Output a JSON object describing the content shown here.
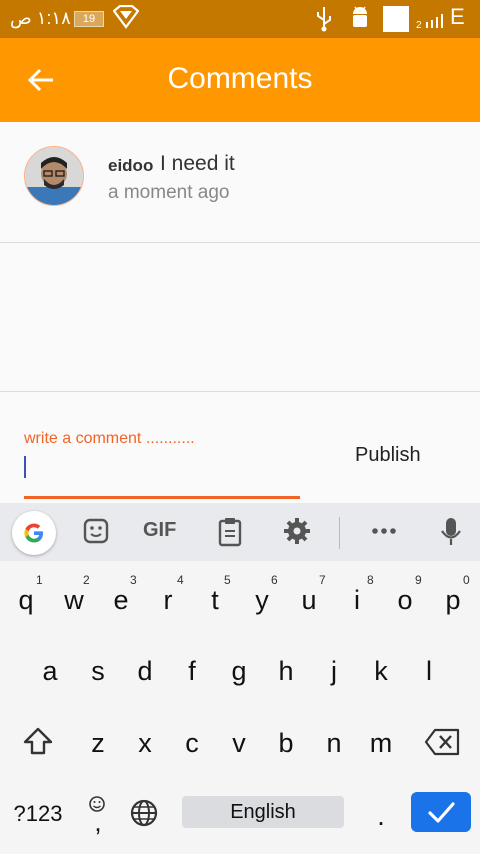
{
  "status_bar": {
    "time": "١:١٨ ص",
    "battery": "19",
    "network": "E",
    "signal": "2"
  },
  "app_bar": {
    "title": "Comments"
  },
  "comment": {
    "user": "eidoo",
    "text": "I need it",
    "time": "a moment ago"
  },
  "composer": {
    "placeholder": "write a comment ...........",
    "publish_label": "Publish"
  },
  "keyboard": {
    "toolbar": {
      "gif_label": "GIF"
    },
    "row1": [
      "q",
      "w",
      "e",
      "r",
      "t",
      "y",
      "u",
      "i",
      "o",
      "p"
    ],
    "row1_hints": [
      "1",
      "2",
      "3",
      "4",
      "5",
      "6",
      "7",
      "8",
      "9",
      "0"
    ],
    "row2": [
      "a",
      "s",
      "d",
      "f",
      "g",
      "h",
      "j",
      "k",
      "l"
    ],
    "row3": [
      "z",
      "x",
      "c",
      "v",
      "b",
      "n",
      "m"
    ],
    "symbols_label": "?123",
    "comma": ",",
    "space_label": "English",
    "period": "."
  }
}
